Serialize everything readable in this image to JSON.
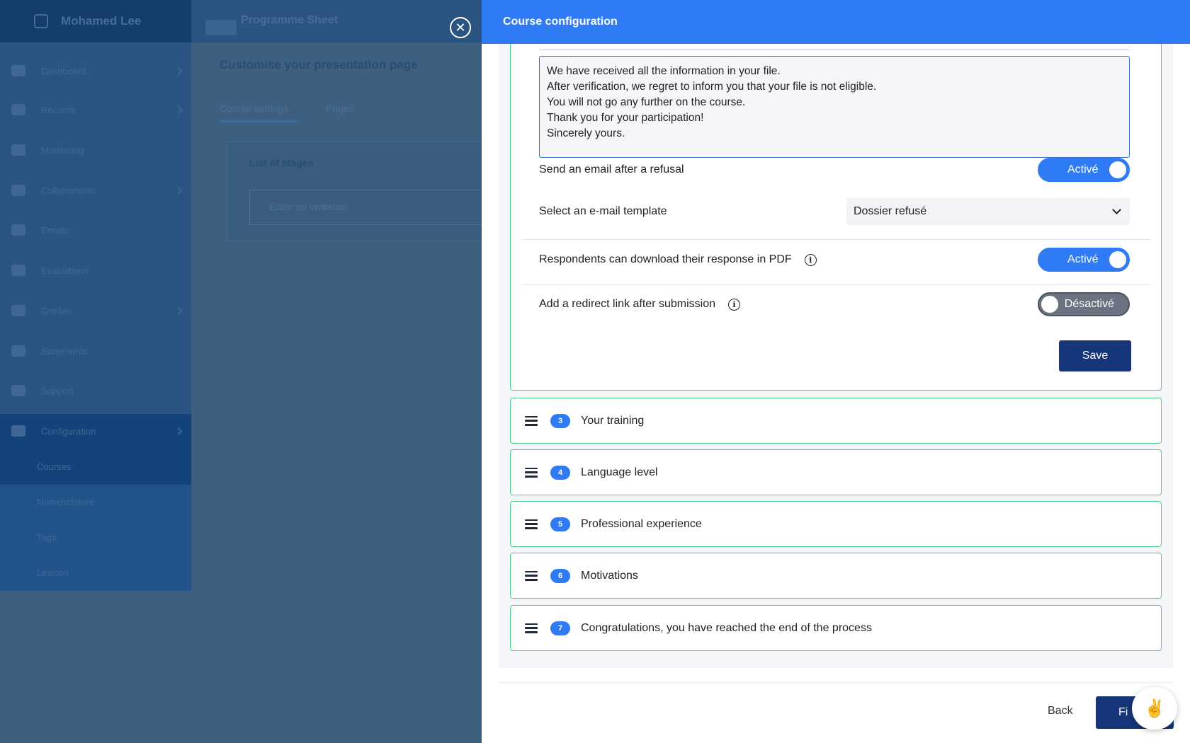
{
  "background": {
    "brand": "Mohamed Lee",
    "nav": [
      "Dashboard",
      "Records",
      "Monitoring",
      "Collaborators",
      "Emails",
      "Evaluations",
      "Grades",
      "Statements",
      "Support"
    ],
    "config_section": "Configuration",
    "config_subitems": [
      "Courses",
      "Nomenclature",
      "Tags",
      "Lexicon"
    ],
    "main_title": "Programme Sheet",
    "page_heading": "Customise your presentation page",
    "tabs": [
      "Course settings",
      "Pages"
    ],
    "card_title": "List of stages",
    "card_input_placeholder": "Enter an invitation"
  },
  "panel": {
    "title": "Course configuration",
    "message_lines": [
      "We have received all the information in your file.",
      "After verification, we regret to inform you that your file is not eligible.",
      "You will not go any further on the course.",
      "Thank you for your participation!",
      "Sincerely yours."
    ],
    "refusal_email": {
      "label": "Send an email after a refusal",
      "state": "Activé"
    },
    "email_template": {
      "label": "Select an e-mail template",
      "value": "Dossier refusé"
    },
    "pdf_download": {
      "label": "Respondents can download their response in PDF",
      "state": "Activé"
    },
    "redirect_link": {
      "label": "Add a redirect link after submission",
      "state": "Désactivé"
    },
    "save_label": "Save",
    "stages": [
      {
        "number": "3",
        "title": "Your training"
      },
      {
        "number": "4",
        "title": "Language level"
      },
      {
        "number": "5",
        "title": "Professional experience"
      },
      {
        "number": "6",
        "title": "Motivations"
      },
      {
        "number": "7",
        "title": "Congratulations, you have reached the end of the process"
      }
    ],
    "back_label": "Back",
    "finish_label": "Fi",
    "chat_icon": "✌️"
  },
  "colors": {
    "primary": "#2f7bf6",
    "dark": "#17357a",
    "stage_border": "#4fcf8c"
  }
}
